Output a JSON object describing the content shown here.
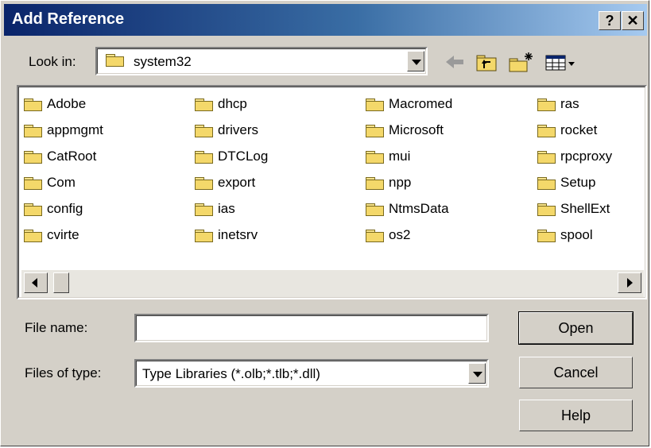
{
  "dialog": {
    "title": "Add Reference",
    "help_glyph": "?",
    "close_glyph": "✕"
  },
  "lookin": {
    "label": "Look in:",
    "value": "system32",
    "icon": "folder-icon"
  },
  "toolbar": {
    "icons": [
      "back-arrow-icon",
      "up-one-level-icon",
      "create-new-folder-icon",
      "view-menu-icon"
    ]
  },
  "folders": [
    [
      "Adobe",
      "appmgmt",
      "CatRoot",
      "Com",
      "config",
      "cvirte"
    ],
    [
      "dhcp",
      "drivers",
      "DTCLog",
      "export",
      "ias",
      "inetsrv"
    ],
    [
      "Macromed",
      "Microsoft",
      "mui",
      "npp",
      "NtmsData",
      "os2"
    ],
    [
      "ras",
      "rocket",
      "rpcproxy",
      "Setup",
      "ShellExt",
      "spool"
    ]
  ],
  "filename": {
    "label": "File name:",
    "value": ""
  },
  "filetype": {
    "label": "Files of type:",
    "value": "Type Libraries (*.olb;*.tlb;*.dll)"
  },
  "buttons": {
    "open": "Open",
    "cancel": "Cancel",
    "help": "Help"
  },
  "colors": {
    "title_start": "#0a246a",
    "title_end": "#a6caf0",
    "face": "#d4d0c8"
  }
}
